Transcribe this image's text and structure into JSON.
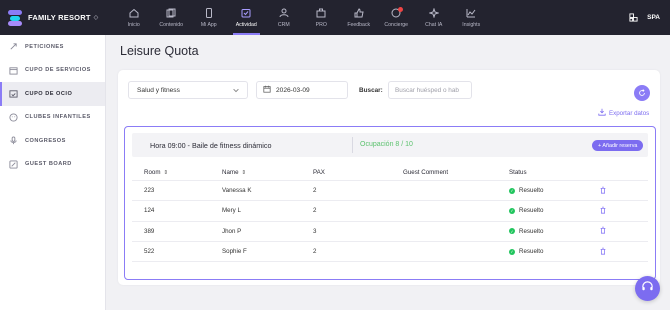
{
  "brand": {
    "name": "FAMILY RESORT"
  },
  "nav": [
    {
      "label": "Inicio",
      "icon": "home-icon"
    },
    {
      "label": "Contenido",
      "icon": "content-icon"
    },
    {
      "label": "Mi App",
      "icon": "phone-icon"
    },
    {
      "label": "Actividad",
      "icon": "activity-icon",
      "active": true
    },
    {
      "label": "CRM",
      "icon": "users-icon"
    },
    {
      "label": "PRO",
      "icon": "briefcase-icon"
    },
    {
      "label": "Feedback",
      "icon": "thumbs-up-icon"
    },
    {
      "label": "Concierge",
      "icon": "chat-icon",
      "badge": true
    },
    {
      "label": "Chat IA",
      "icon": "sparkle-icon"
    },
    {
      "label": "Insights",
      "icon": "chart-icon"
    }
  ],
  "top_right": {
    "label": "SPA",
    "icon": "building-icon"
  },
  "sidebar": {
    "items": [
      {
        "label": "PETICIONES",
        "icon": "request-icon"
      },
      {
        "label": "CUPO DE SERVICIOS",
        "icon": "calendar-icon"
      },
      {
        "label": "CUPO DE OCIO",
        "icon": "calendar-check-icon",
        "active": true
      },
      {
        "label": "CLUBES INFANTILES",
        "icon": "kids-icon"
      },
      {
        "label": "CONGRESOS",
        "icon": "microphone-icon"
      },
      {
        "label": "GUEST BOARD",
        "icon": "board-icon"
      }
    ]
  },
  "page": {
    "title": "Leisure Quota"
  },
  "filters": {
    "category": "Salud y fitness",
    "date": "2026-03-09",
    "search_label": "Buscar:",
    "search_placeholder": "Buscar huésped o hab"
  },
  "export_label": "Exportar datos",
  "activity": {
    "title": "Hora 09:00 - Baile de fitness dinámico",
    "occupancy": "Ocupación 8 / 10",
    "add_label": "+ Añadir reserva",
    "columns": {
      "room": "Room",
      "name": "Name",
      "pax": "PAX",
      "comment": "Guest Comment",
      "status": "Status"
    },
    "rows": [
      {
        "room": "223",
        "name": "Vanessa K",
        "pax": "2",
        "comment": "",
        "status": "Resuelto"
      },
      {
        "room": "124",
        "name": "Mery L",
        "pax": "2",
        "comment": "",
        "status": "Resuelto"
      },
      {
        "room": "389",
        "name": "Jhon P",
        "pax": "3",
        "comment": "",
        "status": "Resuelto"
      },
      {
        "room": "522",
        "name": "Sophie F",
        "pax": "2",
        "comment": "",
        "status": "Resuelto"
      }
    ]
  },
  "colors": {
    "accent": "#8b7cf6",
    "topbar": "#23232f",
    "success": "#22c55e",
    "occupancy": "#5cc26e"
  }
}
